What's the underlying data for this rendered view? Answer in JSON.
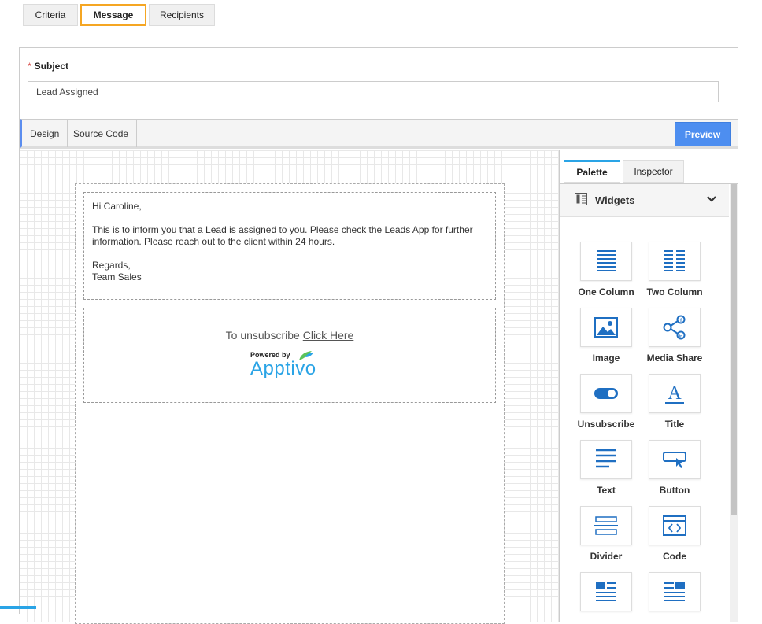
{
  "top_tabs": [
    {
      "label": "Criteria"
    },
    {
      "label": "Message",
      "active": true
    },
    {
      "label": "Recipients"
    }
  ],
  "subject": {
    "required_mark": "*",
    "label": "Subject",
    "value": "Lead Assigned"
  },
  "editor": {
    "tabs": [
      "Design",
      "Source Code"
    ],
    "preview_label": "Preview"
  },
  "email": {
    "greeting": "Hi Caroline,",
    "body_line1": "This is to inform you that a Lead is assigned to you. Please check the Leads App for further",
    "body_line2": "information. Please reach out to the client within 24 hours.",
    "closing": "Regards,",
    "signature": "Team Sales",
    "unsubscribe_text": "To unsubscribe",
    "unsubscribe_link": "Click Here",
    "powered_by": "Powered by",
    "brand": "Apptivo"
  },
  "side_panel": {
    "tabs": [
      "Palette",
      "Inspector"
    ],
    "widgets_title": "Widgets",
    "widgets": [
      {
        "label": "One Column",
        "icon": "one-column-icon"
      },
      {
        "label": "Two Column",
        "icon": "two-column-icon"
      },
      {
        "label": "Image",
        "icon": "image-icon"
      },
      {
        "label": "Media Share",
        "icon": "media-share-icon"
      },
      {
        "label": "Unsubscribe",
        "icon": "toggle-icon"
      },
      {
        "label": "Title",
        "icon": "title-icon"
      },
      {
        "label": "Text",
        "icon": "text-icon"
      },
      {
        "label": "Button",
        "icon": "button-icon"
      },
      {
        "label": "Divider",
        "icon": "divider-icon"
      },
      {
        "label": "Code",
        "icon": "code-icon"
      },
      {
        "label": "",
        "icon": "image-text-icon"
      },
      {
        "label": "",
        "icon": "text-image-icon"
      }
    ]
  },
  "colors": {
    "accent_blue": "#2aa4e6",
    "preview_button": "#4d8ef0",
    "active_tab_border": "#f5a623",
    "required": "#d9534f"
  }
}
